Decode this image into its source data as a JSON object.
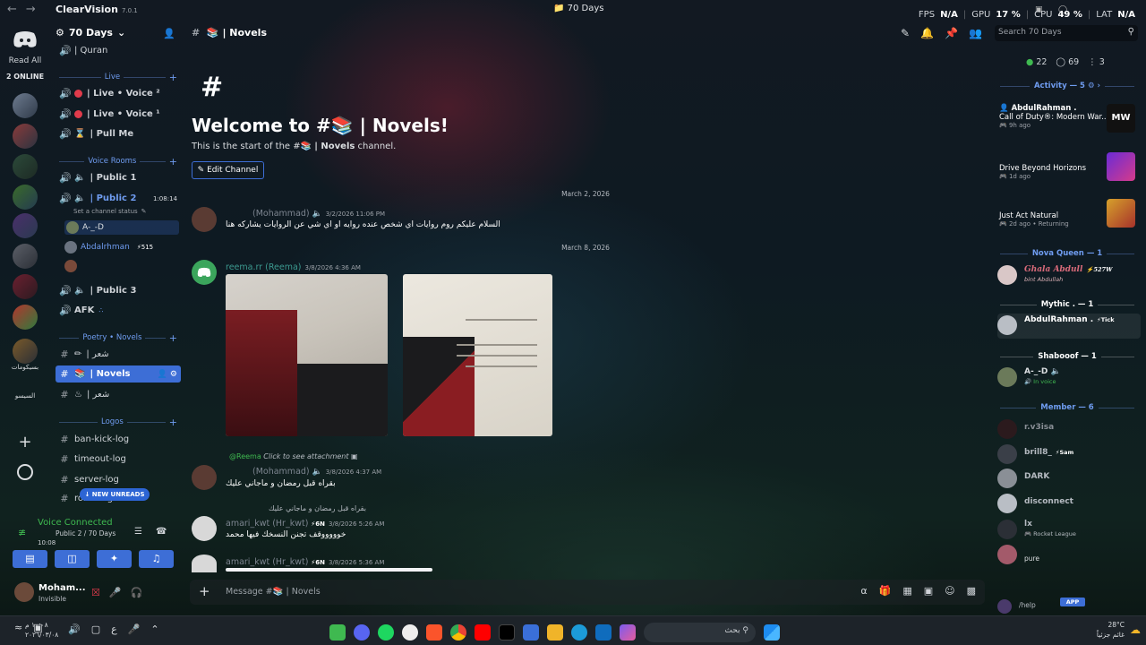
{
  "titlebar": {
    "brand": "ClearVision",
    "version": "7.0.1",
    "window_title": "70 Days",
    "fps_label": "FPS",
    "fps_value": "N/A",
    "gpu_label": "GPU",
    "gpu_value": "17 %",
    "cpu_label": "CPU",
    "cpu_value": "49 %",
    "lat_label": "LAT",
    "lat_value": "N/A"
  },
  "rail": {
    "read_all": "Read All",
    "online": "2 ONLINE",
    "text_a": "بسيكومات",
    "text_b": "السيسو"
  },
  "server": {
    "name": "70 Days"
  },
  "channels": {
    "quran": "| Quran",
    "cat_live": "Live",
    "live_voice_2": "| Live • Voice ²",
    "live_voice_1": "| Live • Voice ¹",
    "pull_me": "| Pull Me",
    "cat_voice_rooms": "Voice Rooms",
    "public_1": "| Public 1",
    "public_2": "| Public 2",
    "public_2_time": "1:08:14",
    "channel_status": "Set a channel status",
    "vc_user_1": "A-_-D",
    "vc_user_2": "Abdalrhman",
    "vc_user_2_badge": "515",
    "public_3": "| Public 3",
    "afk": "AFK",
    "cat_poetry": "Poetry • Novels",
    "poetry_1": "| شعر",
    "novels": "| Novels",
    "poetry_2": "| شعر",
    "cat_logos": "Logos",
    "ban_kick_log": "ban-kick-log",
    "timeout_log": "timeout-log",
    "server_log": "server-log",
    "roles_log": "roles-log",
    "new_unreads": "NEW UNREADS"
  },
  "voice": {
    "title": "Voice Connected",
    "channel": "Public 2 / 70 Days",
    "time": "10:08"
  },
  "user": {
    "name": "Moham...",
    "status": "Invisible"
  },
  "header": {
    "channel": "| Novels",
    "search_placeholder": "Search 70 Days"
  },
  "welcome": {
    "title": "Welcome to #",
    "title_suffix": "| Novels!",
    "subtitle_pre": "This is the start of the #",
    "subtitle_channel": "| Novels",
    "subtitle_post": "channel.",
    "edit_button": "Edit Channel"
  },
  "messages": {
    "date_1": "March 2, 2026",
    "m1_name": "(Mohammad)",
    "m1_time": "3/2/2026 11:06 PM",
    "m1_text": "السلام عليكم روم روايات اي شخص عنده روايه او اي شي عن الروايات يشاركه هنا",
    "date_2": "March 8, 2026",
    "m2_name": "reema.rr (Reema)",
    "m2_time": "3/8/2026 4:36 AM",
    "reply_1_name": "@Reema",
    "reply_1_text": "Click to see attachment",
    "m3_name": "(Mohammad)",
    "m3_time": "3/8/2026 4:37 AM",
    "m3_text": "بقراه قبل رمضان و ماجاني عليك",
    "reply_2_text": "بقراه قبل رمضان و ماجاني عليك",
    "m4_name": "amari_kwt (Hr_kwt)",
    "m4_badge": "6N",
    "m4_time": "3/8/2026 5:26 AM",
    "m4_text": "خوووووقف تجنن النسخك فيها محمد",
    "m5_name": "amari_kwt (Hr_kwt)",
    "m5_badge": "6N",
    "m5_time": "3/8/2026 5:36 AM",
    "composer_placeholder": "Message #",
    "composer_channel": "| Novels"
  },
  "members": {
    "online_count": "22",
    "idle_count": "69",
    "dnd_count": "3",
    "activity_section": "Activity — 5",
    "a1_name": "AbdulRahman .",
    "a1_game": "Call of Duty®: Modern War...",
    "a1_time": "9h ago",
    "a2_game": "Drive Beyond Horizons",
    "a2_time": "1d ago",
    "a3_game": "Just Act Natural",
    "a3_time": "2d ago",
    "a3_status": "Returning",
    "sec_nova": "Nova Queen — 1",
    "nova_1": "Ghala Abdull",
    "nova_1_sub": "bint Abdullah",
    "nova_1_badge": "527W",
    "sec_mythic": "Mythic . — 1",
    "mythic_1": "AbdulRahman .",
    "mythic_1_badge": "Tick",
    "sec_shabooof": "Shabooof — 1",
    "shab_1": "A-_-D",
    "shab_1_sub": "In voice",
    "sec_member": "Member — 6",
    "mem_1": "r.v3isa",
    "mem_2": "brill8_",
    "mem_2_badge": "Sam",
    "mem_3": "DARK",
    "mem_4": "disconnect",
    "mem_5": "lx",
    "mem_5_sub": "Rocket League",
    "mem_6_sub": "pure",
    "help": "/help",
    "app_badge": "APP"
  },
  "taskbar": {
    "time": "١٠:٠٨ م",
    "date": "٢٠٢٦/٠٣/٠٨",
    "search": "بحث",
    "weather_temp": "28°C",
    "weather_text": "غائم جزئياً",
    "lang": "ع"
  },
  "colors": {
    "accent": "#3d6ed6",
    "online": "#3fb950",
    "category": "#6f9cf0",
    "live_dot": "#e03b4b"
  }
}
